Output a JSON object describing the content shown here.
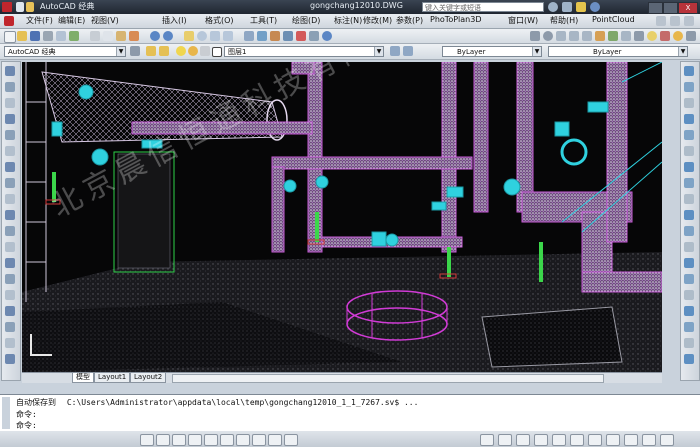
{
  "title": {
    "workspace": "AutoCAD 经典",
    "app_file": "gongchang12010.DWG",
    "search_placeholder": "键入关键字或短语",
    "close_symbol": "X"
  },
  "menu": [
    "文件(F)",
    "编辑(E)",
    "视图(V)",
    "插入(I)",
    "格式(O)",
    "工具(T)",
    "绘图(D)",
    "标注(N)",
    "修改(M)",
    "参数(P)",
    "PhoToPlan3D",
    "窗口(W)",
    "帮助(H)",
    "PointCloud"
  ],
  "toolbar": {
    "workspace_combo": "AutoCAD 经典",
    "layer_combo": "图层1",
    "color_combo": "ByLayer",
    "linetype_combo": "ByLayer"
  },
  "tabs": [
    "模型",
    "Layout1",
    "Layout2"
  ],
  "command": {
    "line1_label": "自动保存到",
    "line1_path": "C:\\Users\\Administrator\\appdata\\local\\temp\\gongchang12010_1_1_7267.sv$ ...",
    "line2_label": "命令:",
    "line3_label": "命令:"
  },
  "watermark": "北京晨信恒通科技有限公司",
  "colors": {
    "magenta": "#c65bd6",
    "cyan": "#2fd1df",
    "green": "#3bd64a",
    "white_cloud": "#d9d2e6"
  }
}
